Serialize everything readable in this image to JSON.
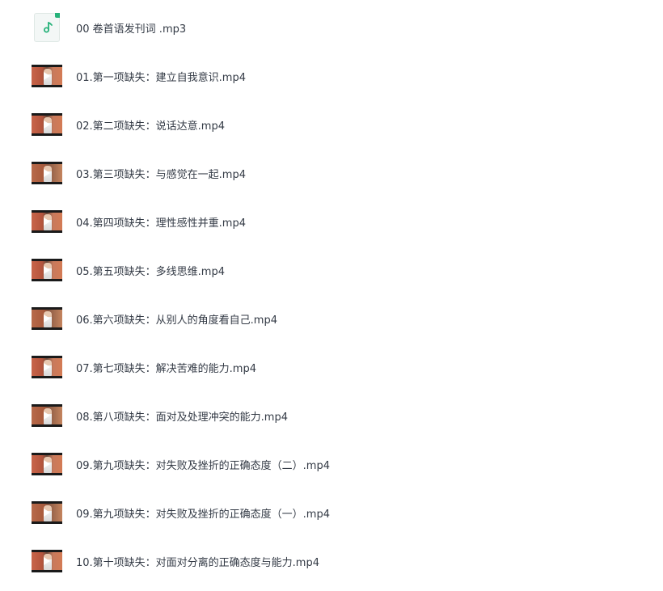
{
  "files": [
    {
      "name": "00 卷首语发刊词 .mp3",
      "type": "audio",
      "icon": "music-note-icon"
    },
    {
      "name": "01.第一项缺失：建立自我意识.mp4",
      "type": "video",
      "icon": "video-thumbnail"
    },
    {
      "name": "02.第二项缺失：说话达意.mp4",
      "type": "video",
      "icon": "video-thumbnail"
    },
    {
      "name": "03.第三项缺失：与感觉在一起.mp4",
      "type": "video",
      "icon": "video-thumbnail"
    },
    {
      "name": "04.第四项缺失：理性感性并重.mp4",
      "type": "video",
      "icon": "video-thumbnail"
    },
    {
      "name": "05.第五项缺失：多线思维.mp4",
      "type": "video",
      "icon": "video-thumbnail"
    },
    {
      "name": "06.第六项缺失：从别人的角度看自己.mp4",
      "type": "video",
      "icon": "video-thumbnail"
    },
    {
      "name": "07.第七项缺失：解决苦难的能力.mp4",
      "type": "video",
      "icon": "video-thumbnail"
    },
    {
      "name": "08.第八项缺失：面对及处理冲突的能力.mp4",
      "type": "video",
      "icon": "video-thumbnail"
    },
    {
      "name": "09.第九项缺失：对失败及挫折的正确态度（二）.mp4",
      "type": "video",
      "icon": "video-thumbnail"
    },
    {
      "name": "09.第九项缺失：对失败及挫折的正确态度（一）.mp4",
      "type": "video",
      "icon": "video-thumbnail"
    },
    {
      "name": "10.第十项缺失：对面对分离的正确态度与能力.mp4",
      "type": "video",
      "icon": "video-thumbnail"
    }
  ],
  "colors": {
    "text": "#333a45",
    "audio_accent": "#27b27a",
    "background": "#ffffff"
  }
}
